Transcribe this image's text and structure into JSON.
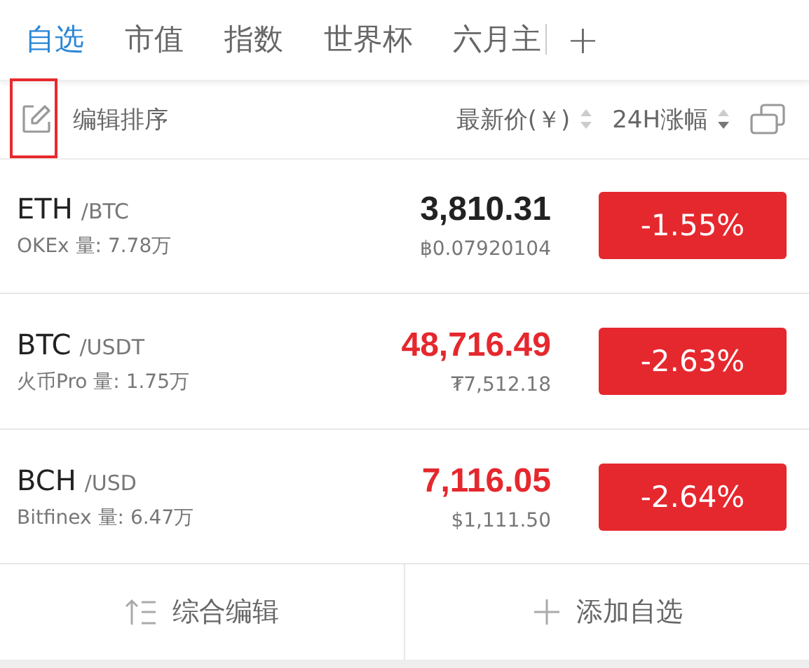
{
  "tabs": [
    {
      "label": "自选",
      "selected": true
    },
    {
      "label": "市值",
      "selected": false
    },
    {
      "label": "指数",
      "selected": false
    },
    {
      "label": "世界杯",
      "selected": false
    },
    {
      "label": "六月主",
      "selected": false
    }
  ],
  "add_tab": "+",
  "header": {
    "edit_label": "编辑排序",
    "edit_highlighted": true,
    "price_label": "最新价(￥)",
    "change_label": "24H涨幅"
  },
  "rows": [
    {
      "base": "ETH",
      "quote": "/BTC",
      "exchange": "OKEx 量: 7.78万",
      "price": "3,810.31",
      "color": "#222222",
      "sub_price": "฿0.07920104",
      "change": "-1.55%"
    },
    {
      "base": "BTC",
      "quote": "/USDT",
      "exchange": "火币Pro 量: 1.75万",
      "price": "48,716.49",
      "color": "#e5282e",
      "sub_price": "₮7,512.18",
      "change": "-2.63%"
    },
    {
      "base": "BCH",
      "quote": "/USD",
      "exchange": "Bitfinex 量: 6.47万",
      "price": "7,116.05",
      "color": "#e5282e",
      "sub_price": "$1,111.50",
      "change": "-2.64%"
    }
  ],
  "footer": {
    "edit_all": "综合编辑",
    "add": "添加自选"
  }
}
